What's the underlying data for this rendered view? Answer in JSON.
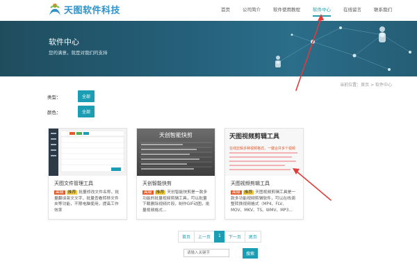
{
  "brand": {
    "name": "天图软件科技"
  },
  "nav": [
    {
      "label": "首页"
    },
    {
      "label": "公司简介"
    },
    {
      "label": "软件使用教程"
    },
    {
      "label": "软件中心"
    },
    {
      "label": "在线留言"
    },
    {
      "label": "联系我们"
    }
  ],
  "banner": {
    "title": "软件中心",
    "subtitle": "您的满意，就是对我们的支持"
  },
  "breadcrumb": "当前位置：首页 > 软件中心",
  "filters": [
    {
      "label": "类型：",
      "button": "全部"
    },
    {
      "label": "颜色：",
      "button": "全部"
    }
  ],
  "cards": [
    {
      "title": "天图文件管理工具",
      "tag1": "高级",
      "tag2": "推荐",
      "desc": "批量修改文件名称、批量翻译英文文字、批量查看转移文件夹等功能，不限电脑使用，提高工作效率"
    },
    {
      "title": "天创智能快剪",
      "tag1": "高级",
      "tag2": "推荐",
      "desc": "天创智能快剪是一款多功能的批量视频剪辑工具，可以批量下载删除视频片段，制作GIF动图，批量视频格式..."
    },
    {
      "title": "天图视频剪辑工具",
      "tag1": "高级",
      "tag2": "推荐",
      "desc": "天图视频剪辑工具是一款多功能视频剪辑软件，可以在线调整转换视频格式（MP4、FLV、MOV、MKV、TS、WMV、MP3..."
    }
  ],
  "thumbs": {
    "t2_title": "天创智能快剪",
    "t3_title": "天图视频剪辑工具",
    "t3_red": "在线剪辑多种视频格式，一键合并多个视频"
  },
  "pagination": [
    "首页",
    "上一页",
    "1",
    "下一页",
    "尾页"
  ],
  "search": {
    "placeholder": "请输入关键字",
    "button": "搜索"
  },
  "colors": {
    "accent": "#1b9db4",
    "banner": "#25607a",
    "arrow": "#e23a3a",
    "tag_red": "#e15a2a",
    "tag_yellow": "#f0c93a"
  }
}
